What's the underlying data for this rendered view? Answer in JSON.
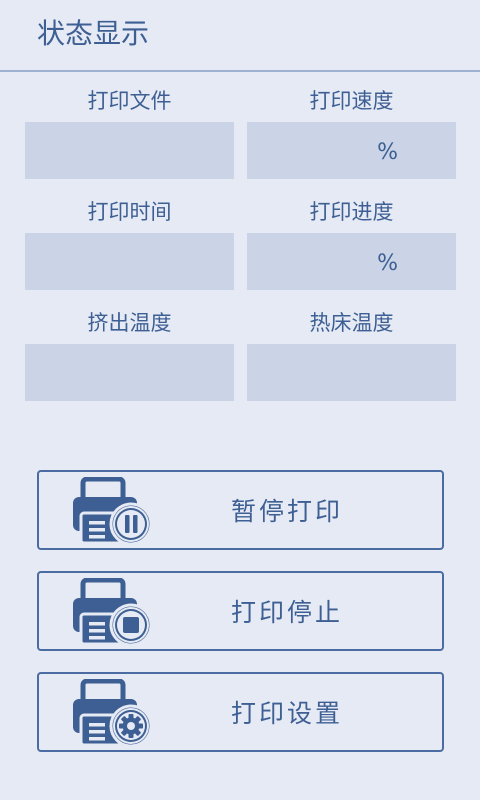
{
  "header": {
    "title": "状态显示"
  },
  "status": {
    "print_file": {
      "label": "打印文件",
      "value": ""
    },
    "print_speed": {
      "label": "打印速度",
      "value": "",
      "unit": "%"
    },
    "print_time": {
      "label": "打印时间",
      "value": ""
    },
    "print_progress": {
      "label": "打印进度",
      "value": "",
      "unit": "%"
    },
    "extruder_temp": {
      "label": "挤出温度",
      "value": ""
    },
    "bed_temp": {
      "label": "热床温度",
      "value": ""
    }
  },
  "actions": {
    "pause": {
      "label": "暂停打印",
      "icon": "printer-pause-icon"
    },
    "stop": {
      "label": "打印停止",
      "icon": "printer-stop-icon"
    },
    "settings": {
      "label": "打印设置",
      "icon": "printer-settings-icon"
    }
  },
  "colors": {
    "background": "#e6eaf4",
    "field": "#cad4e6",
    "accent": "#3d5f93",
    "border": "#4a6ca2"
  }
}
